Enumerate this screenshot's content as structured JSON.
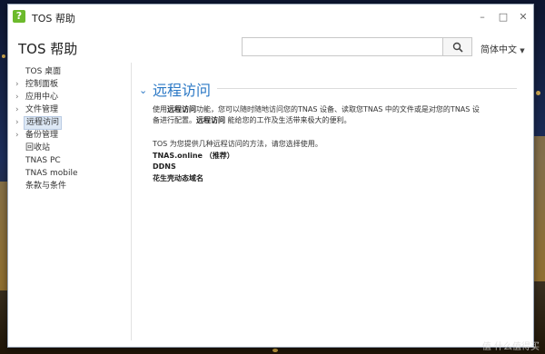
{
  "window": {
    "app_icon_glyph": "?",
    "title": "TOS 帮助"
  },
  "header": {
    "title": "TOS 帮助",
    "search_placeholder": "",
    "language": "简体中文"
  },
  "sidebar": {
    "items": [
      {
        "label": "TOS 桌面",
        "expandable": false
      },
      {
        "label": "控制面板",
        "expandable": true
      },
      {
        "label": "应用中心",
        "expandable": true
      },
      {
        "label": "文件管理",
        "expandable": true
      },
      {
        "label": "远程访问",
        "expandable": true,
        "active": true
      },
      {
        "label": "备份管理",
        "expandable": true
      },
      {
        "label": "回收站",
        "expandable": false
      },
      {
        "label": "TNAS PC",
        "expandable": false
      },
      {
        "label": "TNAS mobile",
        "expandable": false
      },
      {
        "label": "条款与条件",
        "expandable": false
      }
    ]
  },
  "content": {
    "section_title": "远程访问",
    "intro": {
      "p1_a": "使用",
      "p1_b": "远程访问",
      "p1_c": "功能，您可以随时随地访问您的TNAS 设备、读取您TNAS 中的文件或是对您的TNAS 设",
      "p2_a": "备进行配置。",
      "p2_b": "远程访问",
      "p2_c": " 能给您的工作及生活带来极大的便利。"
    },
    "methods_intro": "TOS 为您提供几种远程访问的方法，请您选择使用。",
    "methods": [
      "TNAS.online （推荐）",
      "DDNS",
      "花生壳动态域名"
    ]
  },
  "watermark": "值 什么值得买"
}
